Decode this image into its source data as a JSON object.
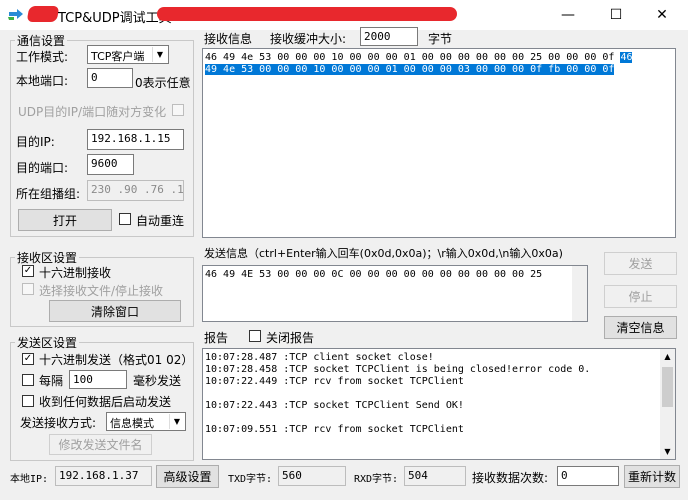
{
  "window": {
    "title": "TCP&UDP调试工具",
    "minimize": "—",
    "maximize": "☐",
    "close": "✕"
  },
  "comm": {
    "legend": "通信设置",
    "mode_label": "工作模式:",
    "mode_value": "TCP客户端",
    "local_port_label": "本地端口:",
    "local_port_value": "0",
    "local_port_hint": "0表示任意",
    "udp_random_label": "UDP目的IP/端口随对方变化",
    "dest_ip_label": "目的IP:",
    "dest_ip_value": "192.168.1.15",
    "dest_port_label": "目的端口:",
    "dest_port_value": "9600",
    "group_label": "所在组播组:",
    "group_value": "230 .90 .76 .1",
    "open_button": "打开",
    "auto_reconnect": "自动重连"
  },
  "recv_settings": {
    "legend": "接收区设置",
    "hex_recv": "十六进制接收",
    "select_file": "选择接收文件/停止接收",
    "clear_button": "清除窗口"
  },
  "send_settings": {
    "legend": "发送区设置",
    "hex_send": "十六进制发送（格式01 02）",
    "every_label": "每隔",
    "every_value": "100",
    "ms_label": "毫秒发送",
    "send_on_recv": "收到任何数据后启动发送",
    "method_label": "发送接收方式:",
    "method_value": "信息模式",
    "modify_button": "修改发送文件名"
  },
  "recv_info": {
    "title": "接收信息",
    "buf_label": "接收缓冲大小:",
    "buf_value": "2000",
    "unit": "字节",
    "line1_pre": "46 49 4e 53 00 00 00 10 00 00 00 01 00 00 00 00 00 00 25 00 00 00 0f",
    "line1_sel": "46",
    "line2_sel": "49 4e 53 00 00 00 10 00 00 00 01 00 00 00 03 00 00 00 0f fb 00 00 0f"
  },
  "send_info": {
    "title": "发送信息（ctrl+Enter输入回车(0x0d,0x0a)；\\r输入0x0d,\\n输入0x0a)",
    "content": "46 49 4E 53 00 00 00 0C 00 00 00 00 00 00 00 00 00 00 25",
    "send_button": "发送",
    "stop_button": "停止",
    "clear_info_button": "清空信息"
  },
  "report": {
    "title": "报告",
    "close_report": "关闭报告",
    "lines": [
      "10:07:28.487 :TCP client socket close!",
      "10:07:28.458 :TCP socket TCPClient is being closed!error code 0.",
      "10:07:22.449 :TCP rcv from socket TCPClient",
      "",
      "10:07:22.443 :TCP socket TCPClient Send OK!",
      "",
      "10:07:09.551 :TCP rcv from socket TCPClient"
    ]
  },
  "status": {
    "local_ip_label": "本地IP:",
    "local_ip_value": "192.168.1.37",
    "advanced_button": "高级设置",
    "txd_label": "TXD字节:",
    "txd_value": "560",
    "rxd_label": "RXD字节:",
    "rxd_value": "504",
    "recv_count_label": "接收数据次数:",
    "recv_count_value": "0",
    "recount_button": "重新计数"
  }
}
